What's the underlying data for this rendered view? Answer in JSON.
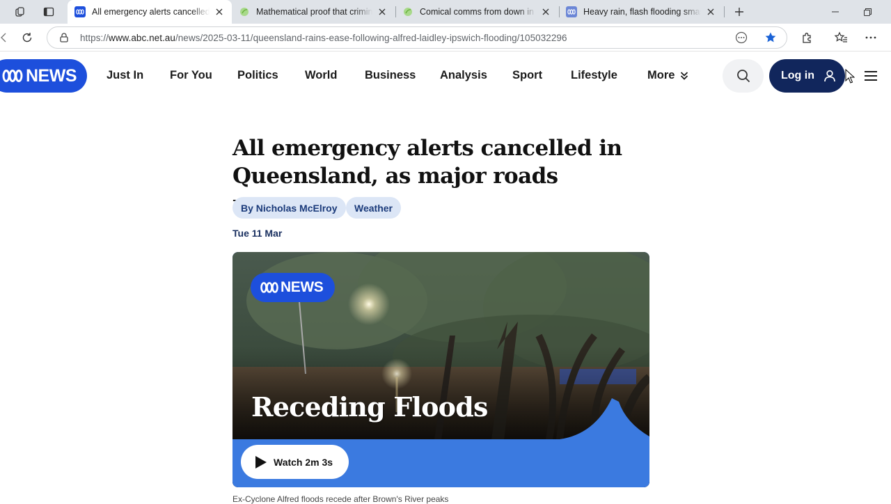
{
  "browser": {
    "tabs": [
      {
        "title": "All emergency alerts cancelled in",
        "active": true,
        "favicon": "abc-favicon"
      },
      {
        "title": "Mathematical proof that criminal",
        "active": false,
        "favicon": "green-leaf-favicon"
      },
      {
        "title": "Comical comms from down in the",
        "active": false,
        "favicon": "green-leaf-favicon"
      },
      {
        "title": "Heavy rain, flash flooding smashe",
        "active": false,
        "favicon": "abc-favicon"
      }
    ],
    "url_prefix": "https://",
    "url_host": "www.abc.net.au",
    "url_path": "/news/2025-03-11/queensland-rains-ease-following-alfred-laidley-ipswich-flooding/105032296",
    "colors": {
      "tabstrip": "#dfe3e8",
      "star": "#1a62d6"
    }
  },
  "site": {
    "logo_text": "NEWS",
    "nav": [
      "Just In",
      "For You",
      "Politics",
      "World",
      "Business",
      "Analysis",
      "Sport",
      "Lifestyle",
      "More"
    ],
    "login_label": "Log in",
    "colors": {
      "brand": "#1d4fdc",
      "login_bg": "#11265c",
      "chip_bg": "#dce6f6"
    }
  },
  "article": {
    "headline": "All emergency alerts cancelled in Queensland, as major roads reopen",
    "byline": "By Nicholas McElroy",
    "topic": "Weather",
    "date": "Tue 11 Mar",
    "video": {
      "badge_text": "NEWS",
      "title": "Receding Floods",
      "watch_label": "Watch 2m 3s"
    },
    "caption": "Ex-Cyclone Alfred floods recede after Brown's River peaks"
  }
}
